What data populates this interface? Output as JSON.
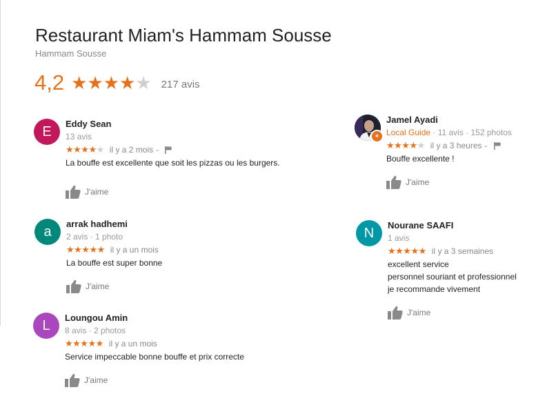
{
  "header": {
    "title": "Restaurant Miam's Hammam Sousse",
    "subtitle": "Hammam Sousse",
    "rating": "4,2",
    "rating_value": 4.2,
    "stars_full": 4,
    "review_count": "217 avis"
  },
  "like_label": "J'aime",
  "colors": {
    "star": "#e7711b",
    "star_empty": "#cfcfcf",
    "local_guide": "#e7711b"
  },
  "reviews": [
    {
      "name": "Eddy Sean",
      "meta": "13 avis",
      "initial": "E",
      "avatar_color": "#c2185b",
      "stars": 4,
      "when": "il y a 2 mois",
      "separator": "-",
      "text": "La bouffe est excellente que soit les pizzas ou les burgers."
    },
    {
      "name": "arrak hadhemi",
      "meta": "2 avis · 1 photo",
      "initial": "a",
      "avatar_color": "#00897b",
      "stars": 5,
      "when": "il y a un mois",
      "text": "La bouffe est super bonne"
    },
    {
      "name": "Loungou Amin",
      "meta": "8 avis · 2 photos",
      "initial": "L",
      "avatar_color": "#ab47bc",
      "stars": 5,
      "when": "il y a un mois",
      "text": "Service impeccable bonne bouffe et prix correcte"
    },
    {
      "name": "Jamel Ayadi",
      "local_guide": "Local Guide",
      "meta": " · 11 avis · 152 photos",
      "avatar": "profile-photo",
      "stars": 4,
      "when": "il y a 3 heures",
      "separator": "-",
      "text": "Bouffe excellente !"
    },
    {
      "name": "Nourane SAAFI",
      "meta": "1 avis",
      "initial": "N",
      "avatar_color": "#0097a7",
      "stars": 5,
      "when": "il y a 3 semaines",
      "text_lines": [
        "excellent service",
        "personnel souriant et professionnel",
        "je recommande vivement"
      ]
    }
  ]
}
